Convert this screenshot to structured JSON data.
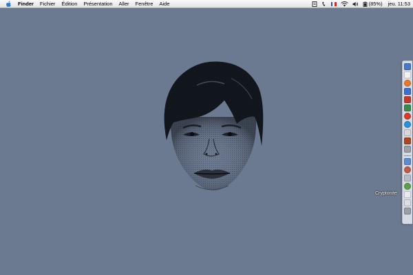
{
  "menubar": {
    "app_name": "Finder",
    "items": [
      "Fichier",
      "Édition",
      "Présentation",
      "Aller",
      "Fenêtre",
      "Aide"
    ],
    "extras": {
      "battery": "(85%)",
      "clock": "jeu. 11:53"
    }
  },
  "dock": {
    "hover_label": "Cryptonite",
    "icons": [
      {
        "name": "finder",
        "color": "#4a78c8"
      },
      {
        "name": "notes",
        "color": "#f2f2f2"
      },
      {
        "name": "firefox",
        "color": "#e8782a"
      },
      {
        "name": "mail",
        "color": "#3a6fd0"
      },
      {
        "name": "ical",
        "color": "#c23a2a"
      },
      {
        "name": "itunes",
        "color": "#3a8a4a"
      },
      {
        "name": "safari",
        "color": "#d83a2a"
      },
      {
        "name": "quicktime",
        "color": "#2a90d8"
      },
      {
        "name": "preview",
        "color": "#d8d8dc"
      },
      {
        "name": "app",
        "color": "#a84820"
      },
      {
        "name": "system-prefs",
        "color": "#9aa0aa"
      },
      {
        "name": "doc",
        "color": "#5a8ad0"
      },
      {
        "name": "user",
        "color": "#c05a4a"
      },
      {
        "name": "printer",
        "color": "#b8bcc4"
      },
      {
        "name": "cryptonite",
        "color": "#5aa04a"
      },
      {
        "name": "folder",
        "color": "#e8eaf0"
      },
      {
        "name": "folder-2",
        "color": "#dcdee4"
      },
      {
        "name": "trash",
        "color": "#9a9ea8"
      }
    ]
  },
  "colors": {
    "desktop": "#6c7a91",
    "menubar": "#f0f0f0"
  }
}
